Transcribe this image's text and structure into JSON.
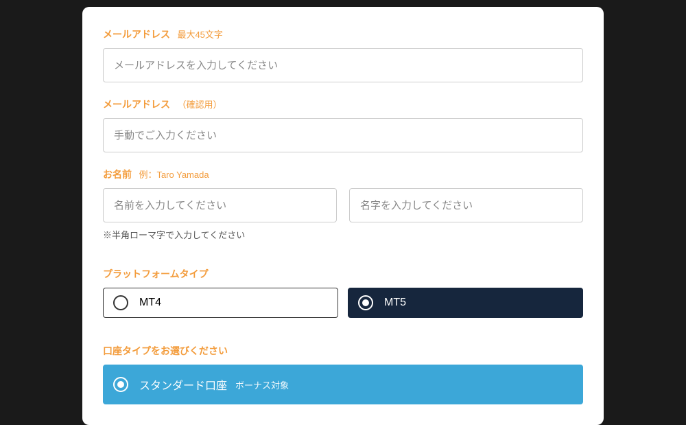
{
  "email": {
    "label": "メールアドレス",
    "hint": "最大45文字",
    "placeholder": "メールアドレスを入力してください"
  },
  "emailConfirm": {
    "label": "メールアドレス",
    "hint": "（確認用）",
    "placeholder": "手動でご入力ください"
  },
  "name": {
    "label": "お名前",
    "hint": "例：Taro Yamada",
    "firstPlaceholder": "名前を入力してください",
    "lastPlaceholder": "名字を入力してください",
    "helper": "※半角ローマ字で入力してください"
  },
  "platform": {
    "label": "プラットフォームタイプ",
    "options": [
      "MT4",
      "MT5"
    ],
    "selected": "MT5"
  },
  "accountType": {
    "label": "口座タイプをお選びください",
    "options": [
      {
        "name": "スタンダード口座",
        "sub": "ボーナス対象"
      }
    ],
    "selected": "スタンダード口座"
  }
}
